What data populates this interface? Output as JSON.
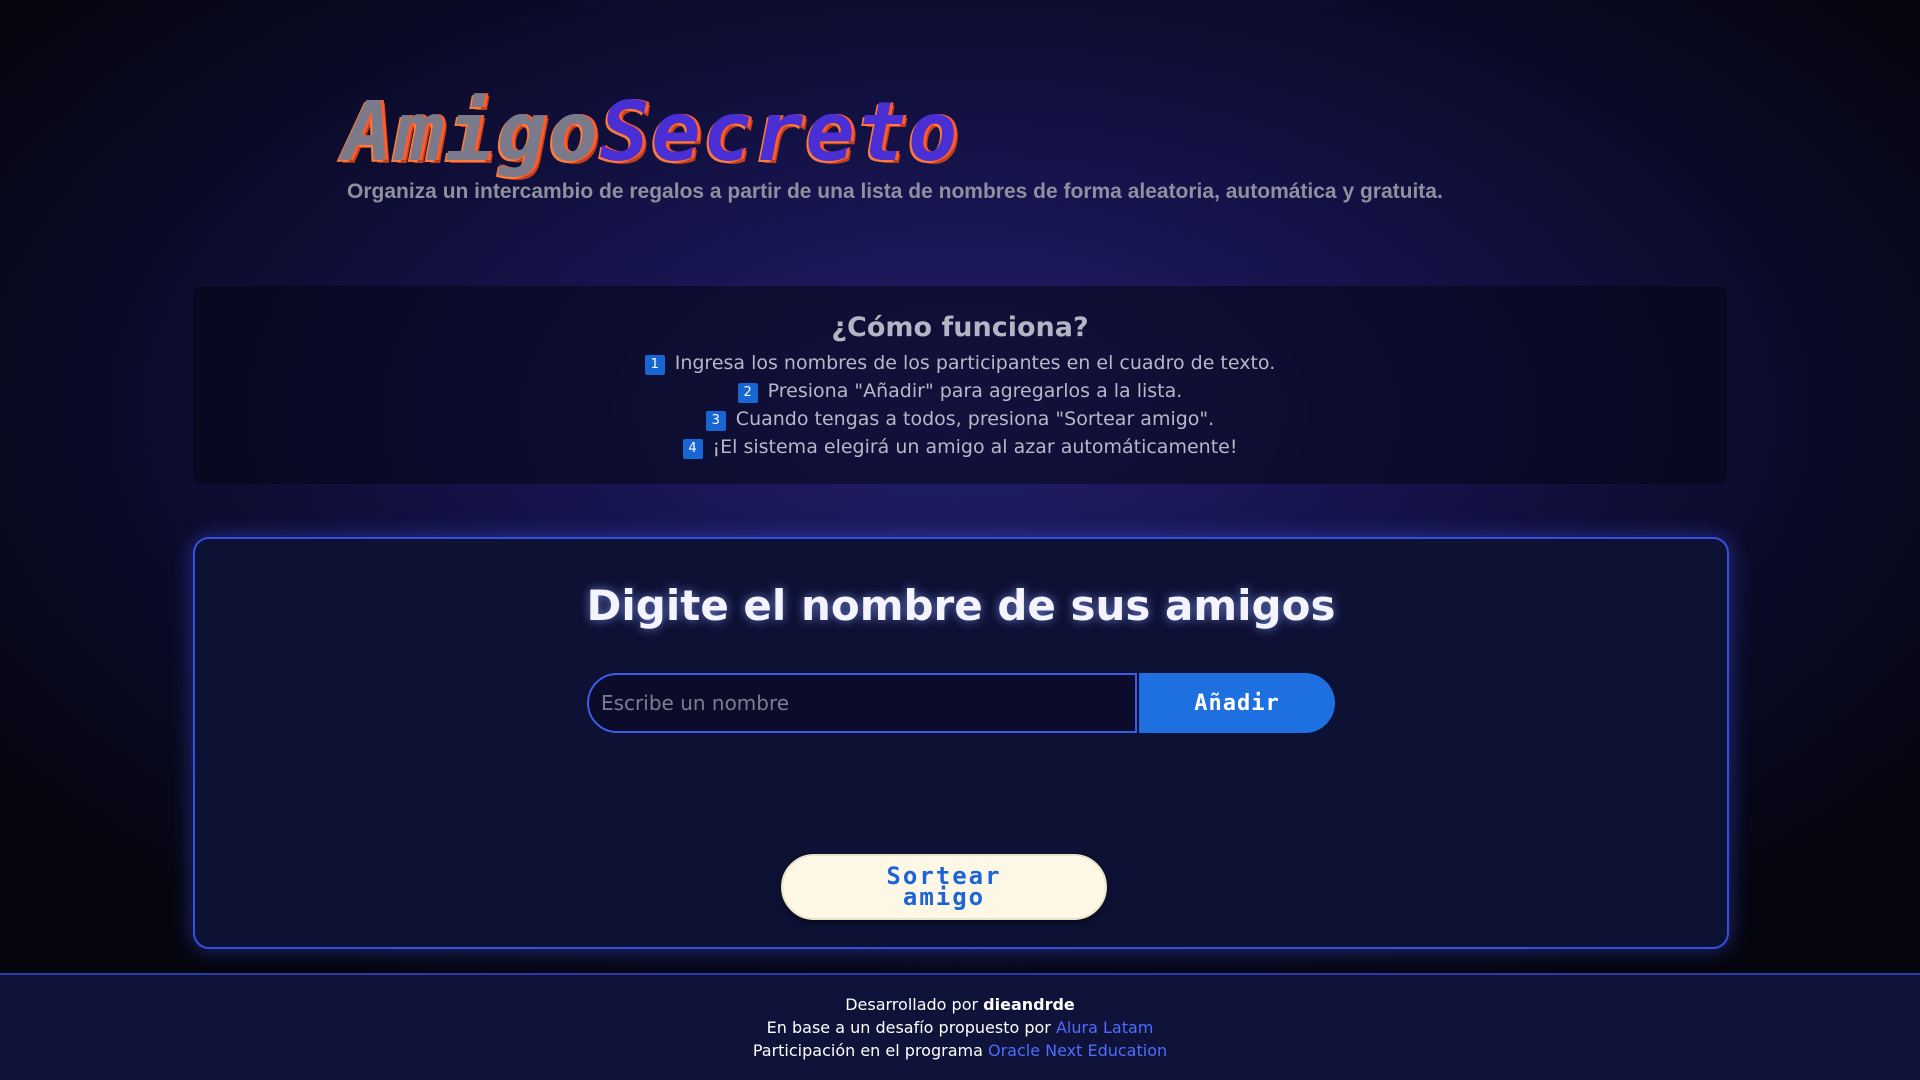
{
  "header": {
    "logo_part1": "Amigo",
    "logo_part2": "Secreto",
    "subtitle": "Organiza un intercambio de regalos a partir de una lista de nombres de forma aleatoria, automática y gratuita."
  },
  "how_it_works": {
    "title": "¿Cómo funciona?",
    "steps": [
      {
        "num": "1",
        "text": "Ingresa los nombres de los participantes en el cuadro de texto."
      },
      {
        "num": "2",
        "text": "Presiona \"Añadir\" para agregarlos a la lista."
      },
      {
        "num": "3",
        "text": "Cuando tengas a todos, presiona \"Sortear amigo\"."
      },
      {
        "num": "4",
        "text": "¡El sistema elegirá un amigo al azar automáticamente!"
      }
    ]
  },
  "main": {
    "title": "Digite el nombre de sus amigos",
    "input_placeholder": "Escribe un nombre",
    "input_value": "",
    "add_label": "Añadir",
    "draw_label": "Sortear amigo"
  },
  "footer": {
    "line1_prefix": "Desarrollado por ",
    "author": "dieandrde",
    "line2_prefix": "En base a un desafío propuesto por ",
    "line2_link": "Alura Latam",
    "line3_prefix": "Participación en el programa ",
    "line3_link": "Oracle Next Education"
  },
  "colors": {
    "accent": "#1e6fe0",
    "card_border": "#3550e0",
    "link": "#4f6cff",
    "logo_outline": "#ff5a2a"
  }
}
